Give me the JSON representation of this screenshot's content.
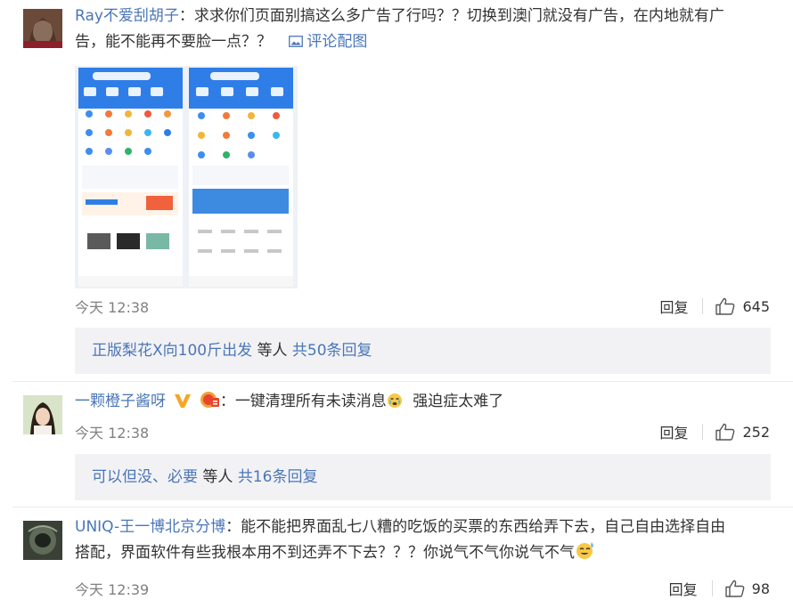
{
  "comments": [
    {
      "username": "Ray不爱刮胡子",
      "colon": "：",
      "text_line1": "求求你们页面别搞这么多广告了行吗？？切换到澳门就没有广告，在内地就有广",
      "text_line2": "告，能不能再不要脸一点？？",
      "image_link_label": "评论配图",
      "time": "今天 12:38",
      "reply_label": "回复",
      "likes": "645",
      "thread": {
        "first_reply_user": "正版梨花X向100斤出发",
        "middle": "等人",
        "total_label": "共50条回复"
      }
    },
    {
      "username": "一颗橙子酱呀",
      "colon": "：",
      "text": "一键清理所有未读消息",
      "text_after_emoji": "强迫症太难了",
      "time": "今天 12:38",
      "reply_label": "回复",
      "likes": "252",
      "thread": {
        "first_reply_user": "可以但没、必要",
        "middle": "等人",
        "total_label": "共16条回复"
      }
    },
    {
      "username": "UNIQ-王一博北京分博",
      "colon": "：",
      "text_line1": "能不能把界面乱七八糟的吃饭的买票的东西给弄下去，自己自由选择自由",
      "text_line2": "搭配，界面软件有些我根本用不到还弄不下去？？？你说气不气你说气不气",
      "time": "今天 12:39",
      "reply_label": "回复",
      "likes": "98"
    }
  ],
  "colors": {
    "link": "#4a76b8",
    "meta": "#808080",
    "subbox_bg": "#f2f2f5",
    "app_blue": "#2f7ee8"
  }
}
